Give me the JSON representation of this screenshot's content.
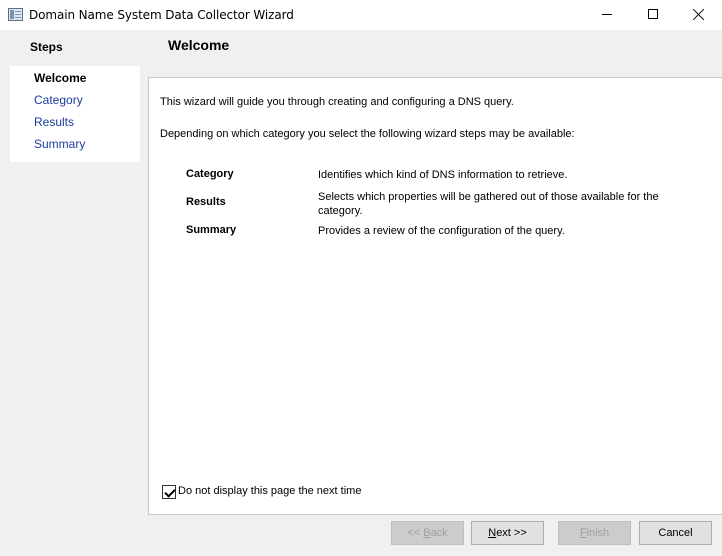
{
  "window": {
    "title": "Domain Name System Data Collector Wizard"
  },
  "steps": {
    "heading": "Steps",
    "items": [
      {
        "label": "Welcome",
        "state": "current"
      },
      {
        "label": "Category",
        "state": "link"
      },
      {
        "label": "Results",
        "state": "link"
      },
      {
        "label": "Summary",
        "state": "link"
      }
    ]
  },
  "header": {
    "title": "Welcome"
  },
  "content": {
    "intro": "This wizard will guide you through creating and configuring a DNS query.",
    "intro2": "Depending on which category you select the following wizard steps may be available:",
    "rows": [
      {
        "label": "Category",
        "desc": "Identifies which kind of DNS information to retrieve."
      },
      {
        "label": "Results",
        "desc": "Selects which properties will be gathered out of those available for the category."
      },
      {
        "label": "Summary",
        "desc": "Provides a review of the configuration of the query."
      }
    ],
    "checkbox_label": "Do not display this page the next time",
    "checkbox_checked": true
  },
  "buttons": {
    "back_prefix": "<< ",
    "back_key": "B",
    "back_rest": "ack",
    "next_key": "N",
    "next_rest": "ext >>",
    "finish_key": "F",
    "finish_rest": "inish",
    "cancel": "Cancel"
  }
}
